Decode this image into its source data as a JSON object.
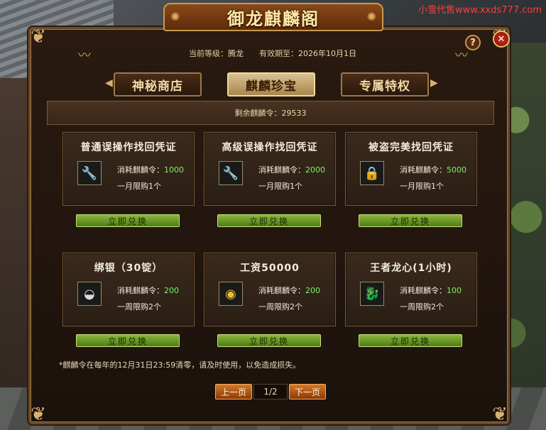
{
  "watermark": "小雪代售www.xxds777.com",
  "window": {
    "title": "御龙麒麟阁",
    "help_label": "?",
    "close_label": "✕"
  },
  "header": {
    "level_label": "当前等级：",
    "level_value": "腾龙",
    "expiry_label": "有效期至：",
    "expiry_value": "2026年10月1日"
  },
  "tabs": [
    {
      "label": "神秘商店",
      "active": false
    },
    {
      "label": "麒麟珍宝",
      "active": true
    },
    {
      "label": "专属特权",
      "active": false
    }
  ],
  "balance": {
    "label": "剩余麒麟令：",
    "value": "29533"
  },
  "items": [
    {
      "title": "普通误操作找回凭证",
      "icon": "wrench-icon",
      "cost_label": "消耗麒麟令：",
      "cost": "1000",
      "limit": "一月限购1个",
      "button": "立即兑换"
    },
    {
      "title": "高级误操作找回凭证",
      "icon": "wrench-icon",
      "cost_label": "消耗麒麟令：",
      "cost": "2000",
      "limit": "一月限购1个",
      "button": "立即兑换"
    },
    {
      "title": "被盗完美找回凭证",
      "icon": "lockbox-icon",
      "cost_label": "消耗麒麟令：",
      "cost": "5000",
      "limit": "一月限购1个",
      "button": "立即兑换"
    },
    {
      "title": "绑银（30锭）",
      "icon": "silver-ingot-icon",
      "cost_label": "消耗麒麟令：",
      "cost": "200",
      "limit": "一周限购2个",
      "button": "立即兑换"
    },
    {
      "title": "工资50000",
      "icon": "gold-coins-icon",
      "cost_label": "消耗麒麟令：",
      "cost": "200",
      "limit": "一周限购2个",
      "button": "立即兑换"
    },
    {
      "title": "王者龙心(1小时)",
      "icon": "dragon-heart-icon",
      "cost_label": "消耗麒麟令：",
      "cost": "100",
      "limit": "一周限购2个",
      "button": "立即兑换"
    }
  ],
  "notice": "*麒麟令在每年的12月31日23:59清零，请及时使用，以免造成损失。",
  "pager": {
    "prev_label": "上一页",
    "page": "1/2",
    "next_label": "下一页"
  }
}
